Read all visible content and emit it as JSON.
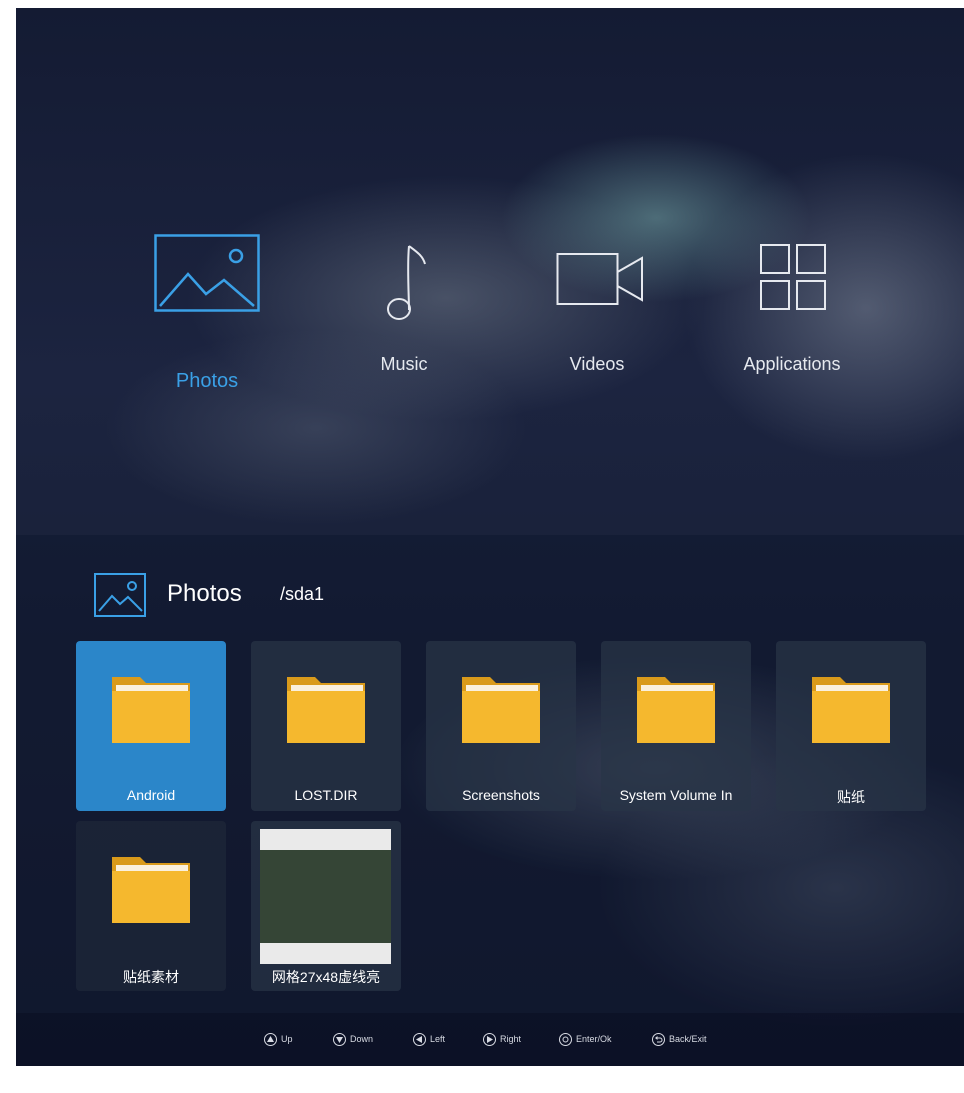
{
  "categories": [
    {
      "label": "Photos",
      "icon": "photo-icon",
      "active": true
    },
    {
      "label": "Music",
      "icon": "music-note-icon",
      "active": false
    },
    {
      "label": "Videos",
      "icon": "video-camera-icon",
      "active": false
    },
    {
      "label": "Applications",
      "icon": "apps-grid-icon",
      "active": false
    }
  ],
  "section": {
    "title": "Photos",
    "path": "/sda1",
    "icon": "photo-icon"
  },
  "items": [
    {
      "name": "Android",
      "type": "folder",
      "selected": true
    },
    {
      "name": "LOST.DIR",
      "type": "folder",
      "selected": false
    },
    {
      "name": "Screenshots",
      "type": "folder",
      "selected": false
    },
    {
      "name": "System Volume In",
      "type": "folder",
      "selected": false
    },
    {
      "name": "贴纸",
      "type": "folder",
      "selected": false
    },
    {
      "name": "贴纸素材",
      "type": "folder",
      "selected": false
    },
    {
      "name": "网格27x48虚线亮",
      "type": "image",
      "selected": false
    }
  ],
  "footer": {
    "hints": [
      {
        "label": "Up",
        "icon": "up-arrow-icon"
      },
      {
        "label": "Down",
        "icon": "down-arrow-icon"
      },
      {
        "label": "Left",
        "icon": "left-arrow-icon"
      },
      {
        "label": "Right",
        "icon": "right-arrow-icon"
      },
      {
        "label": "Enter/Ok",
        "icon": "ok-icon"
      },
      {
        "label": "Back/Exit",
        "icon": "back-icon"
      }
    ]
  },
  "colors": {
    "accent": "#3aa0e6",
    "selected_tile": "#2b86c9",
    "folder": "#f5b82e"
  }
}
